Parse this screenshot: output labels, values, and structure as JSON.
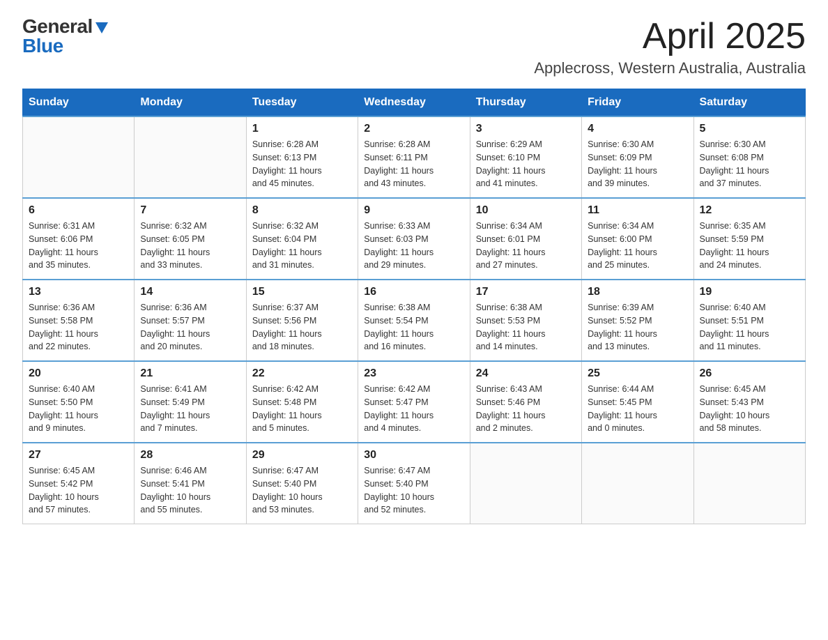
{
  "logo": {
    "general": "General",
    "blue": "Blue"
  },
  "header": {
    "title": "April 2025",
    "subtitle": "Applecross, Western Australia, Australia"
  },
  "days_of_week": [
    "Sunday",
    "Monday",
    "Tuesday",
    "Wednesday",
    "Thursday",
    "Friday",
    "Saturday"
  ],
  "weeks": [
    [
      {
        "day": "",
        "info": ""
      },
      {
        "day": "",
        "info": ""
      },
      {
        "day": "1",
        "info": "Sunrise: 6:28 AM\nSunset: 6:13 PM\nDaylight: 11 hours\nand 45 minutes."
      },
      {
        "day": "2",
        "info": "Sunrise: 6:28 AM\nSunset: 6:11 PM\nDaylight: 11 hours\nand 43 minutes."
      },
      {
        "day": "3",
        "info": "Sunrise: 6:29 AM\nSunset: 6:10 PM\nDaylight: 11 hours\nand 41 minutes."
      },
      {
        "day": "4",
        "info": "Sunrise: 6:30 AM\nSunset: 6:09 PM\nDaylight: 11 hours\nand 39 minutes."
      },
      {
        "day": "5",
        "info": "Sunrise: 6:30 AM\nSunset: 6:08 PM\nDaylight: 11 hours\nand 37 minutes."
      }
    ],
    [
      {
        "day": "6",
        "info": "Sunrise: 6:31 AM\nSunset: 6:06 PM\nDaylight: 11 hours\nand 35 minutes."
      },
      {
        "day": "7",
        "info": "Sunrise: 6:32 AM\nSunset: 6:05 PM\nDaylight: 11 hours\nand 33 minutes."
      },
      {
        "day": "8",
        "info": "Sunrise: 6:32 AM\nSunset: 6:04 PM\nDaylight: 11 hours\nand 31 minutes."
      },
      {
        "day": "9",
        "info": "Sunrise: 6:33 AM\nSunset: 6:03 PM\nDaylight: 11 hours\nand 29 minutes."
      },
      {
        "day": "10",
        "info": "Sunrise: 6:34 AM\nSunset: 6:01 PM\nDaylight: 11 hours\nand 27 minutes."
      },
      {
        "day": "11",
        "info": "Sunrise: 6:34 AM\nSunset: 6:00 PM\nDaylight: 11 hours\nand 25 minutes."
      },
      {
        "day": "12",
        "info": "Sunrise: 6:35 AM\nSunset: 5:59 PM\nDaylight: 11 hours\nand 24 minutes."
      }
    ],
    [
      {
        "day": "13",
        "info": "Sunrise: 6:36 AM\nSunset: 5:58 PM\nDaylight: 11 hours\nand 22 minutes."
      },
      {
        "day": "14",
        "info": "Sunrise: 6:36 AM\nSunset: 5:57 PM\nDaylight: 11 hours\nand 20 minutes."
      },
      {
        "day": "15",
        "info": "Sunrise: 6:37 AM\nSunset: 5:56 PM\nDaylight: 11 hours\nand 18 minutes."
      },
      {
        "day": "16",
        "info": "Sunrise: 6:38 AM\nSunset: 5:54 PM\nDaylight: 11 hours\nand 16 minutes."
      },
      {
        "day": "17",
        "info": "Sunrise: 6:38 AM\nSunset: 5:53 PM\nDaylight: 11 hours\nand 14 minutes."
      },
      {
        "day": "18",
        "info": "Sunrise: 6:39 AM\nSunset: 5:52 PM\nDaylight: 11 hours\nand 13 minutes."
      },
      {
        "day": "19",
        "info": "Sunrise: 6:40 AM\nSunset: 5:51 PM\nDaylight: 11 hours\nand 11 minutes."
      }
    ],
    [
      {
        "day": "20",
        "info": "Sunrise: 6:40 AM\nSunset: 5:50 PM\nDaylight: 11 hours\nand 9 minutes."
      },
      {
        "day": "21",
        "info": "Sunrise: 6:41 AM\nSunset: 5:49 PM\nDaylight: 11 hours\nand 7 minutes."
      },
      {
        "day": "22",
        "info": "Sunrise: 6:42 AM\nSunset: 5:48 PM\nDaylight: 11 hours\nand 5 minutes."
      },
      {
        "day": "23",
        "info": "Sunrise: 6:42 AM\nSunset: 5:47 PM\nDaylight: 11 hours\nand 4 minutes."
      },
      {
        "day": "24",
        "info": "Sunrise: 6:43 AM\nSunset: 5:46 PM\nDaylight: 11 hours\nand 2 minutes."
      },
      {
        "day": "25",
        "info": "Sunrise: 6:44 AM\nSunset: 5:45 PM\nDaylight: 11 hours\nand 0 minutes."
      },
      {
        "day": "26",
        "info": "Sunrise: 6:45 AM\nSunset: 5:43 PM\nDaylight: 10 hours\nand 58 minutes."
      }
    ],
    [
      {
        "day": "27",
        "info": "Sunrise: 6:45 AM\nSunset: 5:42 PM\nDaylight: 10 hours\nand 57 minutes."
      },
      {
        "day": "28",
        "info": "Sunrise: 6:46 AM\nSunset: 5:41 PM\nDaylight: 10 hours\nand 55 minutes."
      },
      {
        "day": "29",
        "info": "Sunrise: 6:47 AM\nSunset: 5:40 PM\nDaylight: 10 hours\nand 53 minutes."
      },
      {
        "day": "30",
        "info": "Sunrise: 6:47 AM\nSunset: 5:40 PM\nDaylight: 10 hours\nand 52 minutes."
      },
      {
        "day": "",
        "info": ""
      },
      {
        "day": "",
        "info": ""
      },
      {
        "day": "",
        "info": ""
      }
    ]
  ]
}
